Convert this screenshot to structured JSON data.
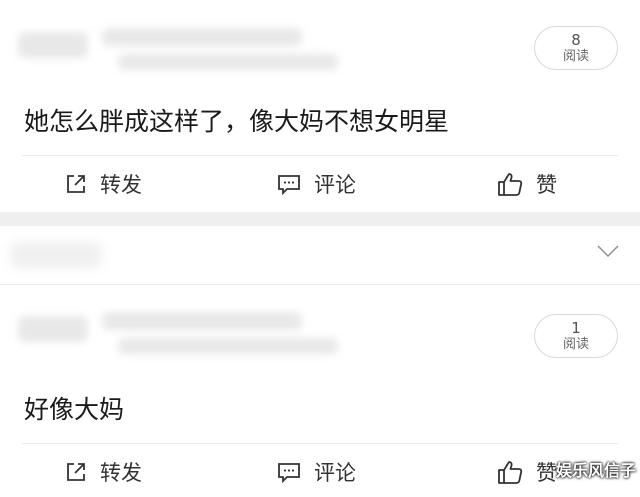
{
  "posts": [
    {
      "read_count": "8",
      "read_label": "阅读",
      "text": "她怎么胖成这样了，像大妈不想女明星",
      "actions": {
        "forward": "转发",
        "comment": "评论",
        "like": "赞"
      }
    },
    {
      "read_count": "1",
      "read_label": "阅读",
      "text": "好像大妈",
      "actions": {
        "forward": "转发",
        "comment": "评论",
        "like": "赞"
      }
    }
  ],
  "watermark": "娱乐风信子",
  "icons": {
    "forward": "share-arrow-icon",
    "comment": "comment-bubble-icon",
    "like": "thumbs-up-icon",
    "expand": "chevron-down-icon"
  },
  "colors": {
    "background": "#ffffff",
    "separator": "#efefef",
    "text": "#1a1a1a",
    "icon": "#333333"
  }
}
